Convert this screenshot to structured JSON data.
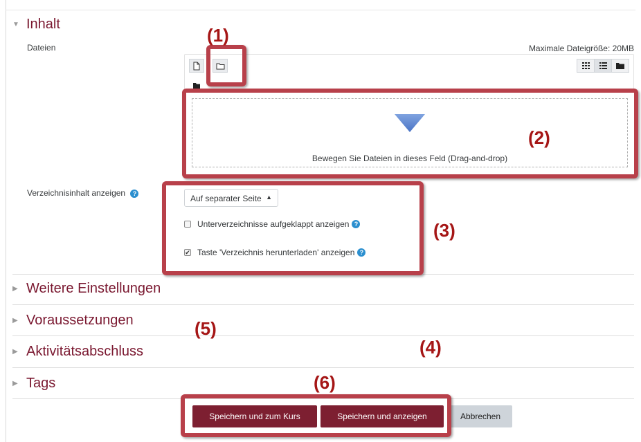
{
  "sections": {
    "inhalt": "Inhalt",
    "weitere": "Weitere Einstellungen",
    "voraussetzungen": "Voraussetzungen",
    "abschluss": "Aktivitätsabschluss",
    "tags": "Tags"
  },
  "files": {
    "label": "Dateien",
    "max_size": "Maximale Dateigröße: 20MB",
    "dropzone_text": "Bewegen Sie Dateien in dieses Feld (Drag-and-drop)"
  },
  "display": {
    "label": "Verzeichnisinhalt anzeigen",
    "selected_option": "Auf separater Seite",
    "checkbox_subfolders": "Unterverzeichnisse aufgeklappt anzeigen",
    "checkbox_download": "Taste 'Verzeichnis herunterladen' anzeigen"
  },
  "buttons": {
    "save_return": "Speichern und zum Kurs",
    "save_display": "Speichern und anzeigen",
    "cancel": "Abbrechen"
  },
  "annotations": {
    "a1": "(1)",
    "a2": "(2)",
    "a3": "(3)",
    "a4": "(4)",
    "a5": "(5)",
    "a6": "(6)"
  },
  "colors": {
    "brand": "#7d1f31",
    "callout": "#b8404a",
    "annotation": "#a51616",
    "help": "#2b8fcf"
  },
  "icons": {
    "collapse": "chevron-down-icon",
    "expand": "chevron-right-icon",
    "add_file": "file-icon",
    "create_folder": "folder-icon",
    "help": "help-icon",
    "arrow": "drop-arrow-icon"
  }
}
